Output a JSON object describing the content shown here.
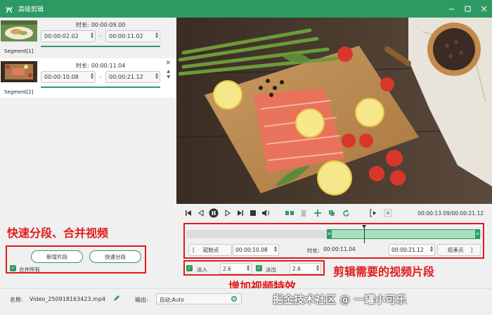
{
  "app": {
    "title": "高级剪辑"
  },
  "segments": [
    {
      "name": "Segment[1]",
      "duration_label": "时长:",
      "duration": "00:00:09.00",
      "start": "00:00:02.02",
      "end": "00:00:11.02"
    },
    {
      "name": "Segment[2]",
      "duration_label": "时长:",
      "duration": "00:00:11.04",
      "start": "00:00:10.08",
      "end": "00:00:21.12"
    }
  ],
  "left_controls": {
    "add_segment": "新增片段",
    "quick_split": "快速分段",
    "merge_all": "合并所有"
  },
  "annotations": {
    "quick_split_merge": "快速分段、合并视频",
    "trim_needed": "剪辑需要的视频片段",
    "add_effects": "增加视频特效"
  },
  "player": {
    "timecode": "00:00:13.09/00:00:21.12",
    "selection_start_fraction": 0.476,
    "selection_end_fraction": 1.0,
    "playhead_fraction": 0.602
  },
  "edit": {
    "start_point": "起始点",
    "start_value": "00:00:10.08",
    "duration_label": "时长:",
    "duration_value": "00:00:11.04",
    "end_value": "00:00:21.12",
    "end_point": "结束点",
    "fade_in_label": "淡入",
    "fade_in_value": "2.6",
    "fade_out_label": "淡出",
    "fade_out_value": "2.6"
  },
  "bottom": {
    "name_label": "名称:",
    "filename": "Video_250918163423.mp4",
    "output_label": "输出:",
    "output_value": "自动;Auto"
  },
  "watermark": {
    "text": "掘金技术社区 @ 一罐小可乐"
  },
  "colors": {
    "accent": "#2e9a63",
    "annotation": "#e01b1b",
    "selection": "#a8dfbd"
  }
}
